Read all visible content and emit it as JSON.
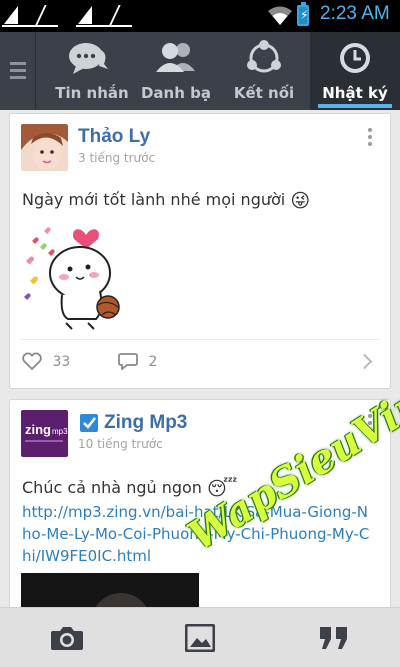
{
  "status_bar": {
    "time": "2:23 AM",
    "icons": [
      "sim1-signal-icon",
      "sim2-signal-icon",
      "wifi-icon",
      "battery-charging-icon"
    ],
    "accent": "#4fb4ea"
  },
  "tabs": [
    {
      "label": "Tin nhắn",
      "icon": "chat-bubbles-icon",
      "active": false
    },
    {
      "label": "Danh bạ",
      "icon": "contacts-icon",
      "active": false
    },
    {
      "label": "Kết nối",
      "icon": "connect-network-icon",
      "active": false
    },
    {
      "label": "Nhật ký",
      "icon": "clock-icon",
      "active": true
    }
  ],
  "feed": [
    {
      "author": "Thảo Ly",
      "time": "3 tiếng trước",
      "text": "Ngày mới tốt lành nhé mọi người",
      "emoji": "😜",
      "sticker": "cute-character-holding-ball-sticker",
      "likes": "33",
      "comments": "2"
    },
    {
      "author": "Zing Mp3",
      "verified": true,
      "avatar_text": "zing",
      "avatar_sub": "mp3",
      "time": "10 tiếng trước",
      "text": "Chúc cả nhà ngủ ngon",
      "emoji": "😴",
      "link": "http://mp3.zing.vn/bai-hat/LK-Sa-Mua-Giong-Nho-Me-Ly-Mo-Coi-Phuong-My-Chi-Phuong-My-Chi/IW9FE0IC.html"
    }
  ],
  "bottom_bar": [
    "camera-icon",
    "photo-gallery-icon",
    "quote-icon"
  ],
  "watermark": "WapSieuVip.Me",
  "colors": {
    "tabbar": "#3b4049",
    "active_tab": "#2a2e35",
    "tab_indicator": "#58b3e8",
    "author": "#3d6ea8",
    "link": "#2b7ec0"
  }
}
